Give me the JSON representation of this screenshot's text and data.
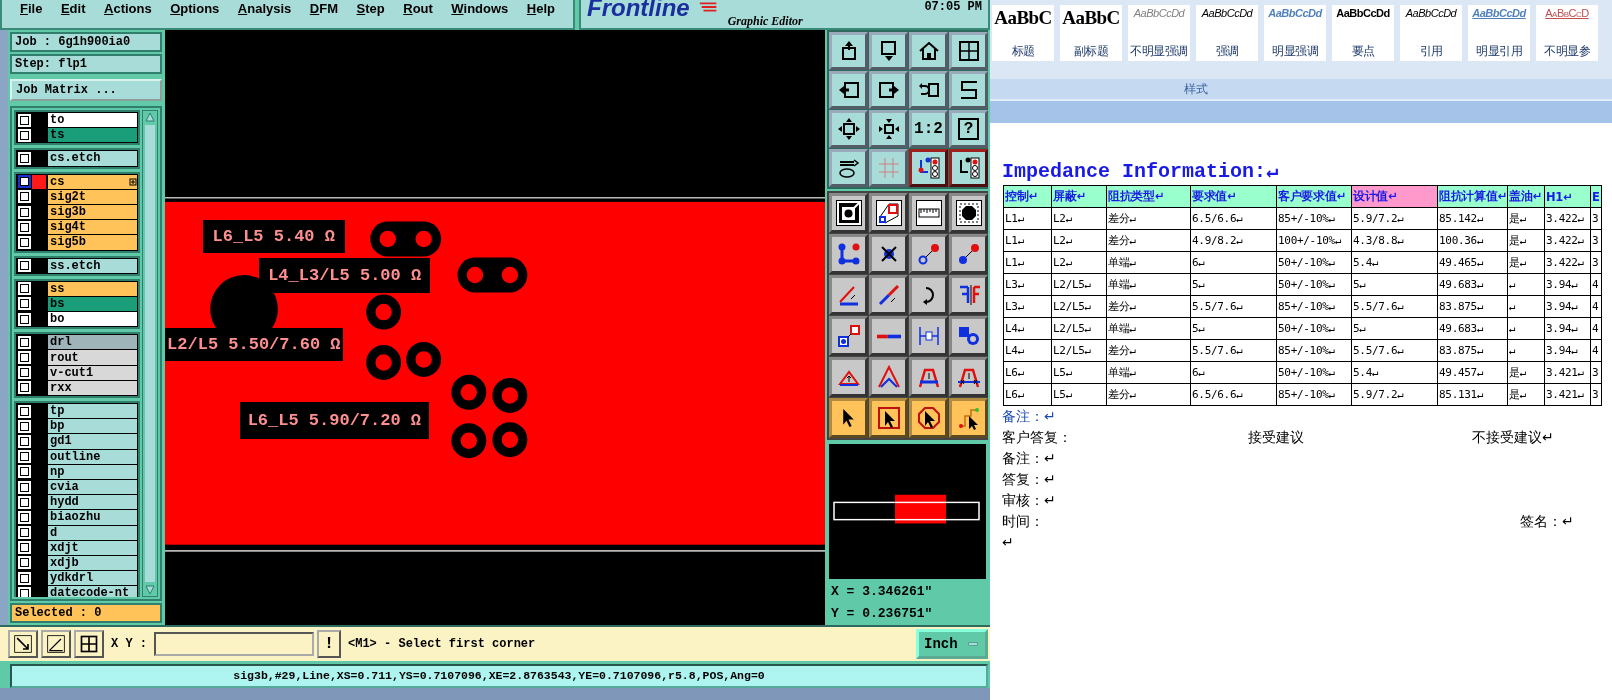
{
  "menu_bar": {
    "items": [
      "File",
      "Edit",
      "Actions",
      "Options",
      "Analysis",
      "DFM",
      "Step",
      "Rout",
      "Windows",
      "Help"
    ],
    "logo": "Frontline",
    "subtitle": "Graphic Editor",
    "clock": "07:05 PM"
  },
  "job_panel": {
    "job": "Job : 6g1h900ia0",
    "step": "Step: flp1",
    "matrix_button": "Job Matrix ...",
    "layer_groups": [
      [
        {
          "name": "to",
          "color": "#ffffff",
          "active": false,
          "checked": false
        },
        {
          "name": "ts",
          "color": "#1a9e7a",
          "active": false,
          "checked": false
        }
      ],
      [
        {
          "name": "cs.etch",
          "color": "#a8dcd8",
          "active": false,
          "checked": false
        }
      ],
      [
        {
          "name": "cs",
          "color": "#ffc35a",
          "active": true,
          "checked": false
        },
        {
          "name": "sig2t",
          "color": "#ffc35a",
          "active": false,
          "checked": false
        },
        {
          "name": "sig3b",
          "color": "#ffc35a",
          "active": false,
          "checked": false
        },
        {
          "name": "sig4t",
          "color": "#ffc35a",
          "active": false,
          "checked": false
        },
        {
          "name": "sig5b",
          "color": "#ffc35a",
          "active": false,
          "checked": false
        }
      ],
      [
        {
          "name": "ss.etch",
          "color": "#a8dcd8",
          "active": false,
          "checked": false
        }
      ],
      [
        {
          "name": "ss",
          "color": "#ffc35a",
          "active": false,
          "checked": false
        },
        {
          "name": "bs",
          "color": "#1a9e7a",
          "active": false,
          "checked": false
        },
        {
          "name": "bo",
          "color": "#ffffff",
          "active": false,
          "checked": false
        }
      ],
      [
        {
          "name": "drl",
          "color": "#9fb4b8",
          "active": false,
          "checked": false
        },
        {
          "name": "rout",
          "color": "#d8d8d8",
          "active": false,
          "checked": false
        },
        {
          "name": "v-cut1",
          "color": "#d8d8d8",
          "active": false,
          "checked": false
        },
        {
          "name": "rxx",
          "color": "#d8d8d8",
          "active": false,
          "checked": false
        }
      ],
      [
        {
          "name": "tp",
          "color": "#a8dcd8",
          "active": false,
          "checked": false
        },
        {
          "name": "bp",
          "color": "#a8dcd8",
          "active": false,
          "checked": false
        },
        {
          "name": "gd1",
          "color": "#a8dcd8",
          "active": false,
          "checked": false
        },
        {
          "name": "outline",
          "color": "#a8dcd8",
          "active": false,
          "checked": false
        },
        {
          "name": "np",
          "color": "#a8dcd8",
          "active": false,
          "checked": false
        },
        {
          "name": "cvia",
          "color": "#a8dcd8",
          "active": false,
          "checked": false
        },
        {
          "name": "hydd",
          "color": "#a8dcd8",
          "active": false,
          "checked": false
        },
        {
          "name": "biaozhu",
          "color": "#a8dcd8",
          "active": false,
          "checked": false
        },
        {
          "name": "d",
          "color": "#a8dcd8",
          "active": false,
          "checked": false
        },
        {
          "name": "xdjt",
          "color": "#a8dcd8",
          "active": false,
          "checked": false
        },
        {
          "name": "xdjb",
          "color": "#a8dcd8",
          "active": false,
          "checked": false
        },
        {
          "name": "ydkdrl",
          "color": "#a8dcd8",
          "active": false,
          "checked": false
        },
        {
          "name": "datecode-nt",
          "color": "#a8dcd8",
          "active": false,
          "checked": false
        }
      ]
    ],
    "selected_count": "Selected : 0"
  },
  "canvas": {
    "labels": [
      "L6_L5 5.40 Ω",
      "L4_L3/L5 5.00 Ω",
      "L2/L5 5.50/7.60 Ω",
      "L6_L5 5.90/7.20 Ω"
    ]
  },
  "tool_palette": {
    "ratio_label": "1:2",
    "help_label": "?"
  },
  "coordinates": {
    "x": "X = 3.346261\"",
    "y": "Y = 0.236751\""
  },
  "command_bar": {
    "xy_label": "X Y :",
    "alert_button": "!",
    "message": "<M1> - Select first corner",
    "units": "Inch"
  },
  "status_line": "sig3b,#29,Line,XS=0.711,YS=0.7107096,XE=2.8763543,YE=0.7107096,r5.8,POS,Ang=0",
  "ribbon": {
    "styles": [
      {
        "sample": "AaBbC",
        "label": "标题",
        "kind": "title"
      },
      {
        "sample": "AaBbC",
        "label": "副标题",
        "kind": "subtitle"
      },
      {
        "sample": "AaBbCcDd",
        "label": "不明显强调",
        "kind": "subtle"
      },
      {
        "sample": "AaBbCcDd",
        "label": "强调",
        "kind": "emphasis"
      },
      {
        "sample": "AaBbCcDd",
        "label": "明显强调",
        "kind": "intense"
      },
      {
        "sample": "AaBbCcDd",
        "label": "要点",
        "kind": "strong"
      },
      {
        "sample": "AaBbCcDd",
        "label": "引用",
        "kind": "quote"
      },
      {
        "sample": "AaBbCcDd",
        "label": "明显引用",
        "kind": "intense_quote"
      },
      {
        "sample": "AaBbCcD",
        "label": "不明显参",
        "kind": "reference"
      }
    ],
    "group_label": "样式"
  },
  "document": {
    "title": "Impedance Information:↵",
    "table": {
      "columns": [
        {
          "label": "控制↵",
          "color": "#99ffcc"
        },
        {
          "label": "屏蔽↵",
          "color": "#99ffcc"
        },
        {
          "label": "阻抗类型↵",
          "color": "#99ffcc"
        },
        {
          "label": "要求值↵",
          "color": "#99ffcc"
        },
        {
          "label": "客户要求值↵",
          "color": "#99ffcc"
        },
        {
          "label": "设计值↵",
          "color": "#ff99cc"
        },
        {
          "label": "阻抗计算值↵",
          "color": "#99ffcc"
        },
        {
          "label": "盖油↵",
          "color": "#99ffcc"
        },
        {
          "label": "H1↵",
          "color": "#99ffcc"
        },
        {
          "label": "E",
          "color": "#99ffcc"
        }
      ],
      "rows": [
        [
          "L1↵",
          "L2↵",
          "差分↵",
          "6.5/6.6↵",
          "85+/-10%↵",
          "5.9/7.2↵",
          "85.142↵",
          "是↵",
          "3.422↵",
          "3"
        ],
        [
          "L1↵",
          "L2↵",
          "差分↵",
          "4.9/8.2↵",
          "100+/-10%↵",
          "4.3/8.8↵",
          "100.36↵",
          "是↵",
          "3.422↵",
          "3"
        ],
        [
          "L1↵",
          "L2↵",
          "单端↵",
          "6↵",
          "50+/-10%↵",
          "5.4↵",
          "49.465↵",
          "是↵",
          "3.422↵",
          "3"
        ],
        [
          "L3↵",
          "L2/L5↵",
          "单端↵",
          "5↵",
          "50+/-10%↵",
          "5↵",
          "49.683↵",
          "↵",
          "3.94↵",
          "4"
        ],
        [
          "L3↵",
          "L2/L5↵",
          "差分↵",
          "5.5/7.6↵",
          "85+/-10%↵",
          "5.5/7.6↵",
          "83.875↵",
          "↵",
          "3.94↵",
          "4"
        ],
        [
          "L4↵",
          "L2/L5↵",
          "单端↵",
          "5↵",
          "50+/-10%↵",
          "5↵",
          "49.683↵",
          "↵",
          "3.94↵",
          "4"
        ],
        [
          "L4↵",
          "L2/L5↵",
          "差分↵",
          "5.5/7.6↵",
          "85+/-10%↵",
          "5.5/7.6↵",
          "83.875↵",
          "↵",
          "3.94↵",
          "4"
        ],
        [
          "L6↵",
          "L5↵",
          "单端↵",
          "6↵",
          "50+/-10%↵",
          "5.4↵",
          "49.457↵",
          "是↵",
          "3.421↵",
          "3"
        ],
        [
          "L6↵",
          "L5↵",
          "差分↵",
          "6.5/6.6↵",
          "85+/-10%↵",
          "5.9/7.2↵",
          "85.131↵",
          "是↵",
          "3.421↵",
          "3"
        ]
      ]
    },
    "notes": [
      {
        "kind": "heading",
        "parts": [
          "备注：↵"
        ]
      },
      {
        "kind": "reply",
        "parts": [
          "客户答复：",
          "接受建议",
          "不接受建议↵"
        ]
      },
      {
        "kind": "plain",
        "parts": [
          "备注：↵"
        ]
      },
      {
        "kind": "plain",
        "parts": [
          "答复：↵"
        ]
      },
      {
        "kind": "plain",
        "parts": [
          "审核：↵"
        ]
      },
      {
        "kind": "signature",
        "parts": [
          "时间：",
          "签名：↵"
        ]
      },
      {
        "kind": "plain",
        "parts": [
          "↵"
        ]
      }
    ]
  }
}
